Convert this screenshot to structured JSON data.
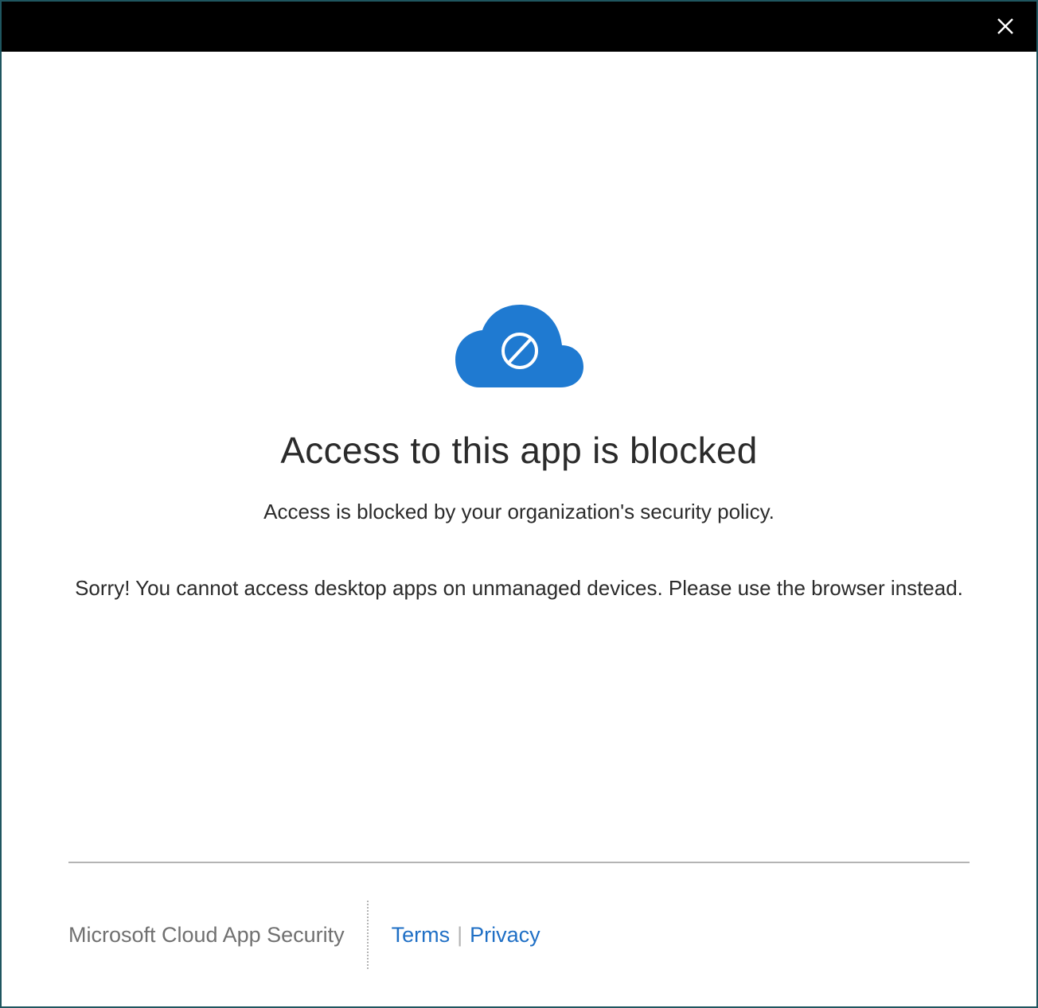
{
  "titlebar": {
    "close_icon": "close-icon"
  },
  "main": {
    "icon": "cloud-blocked-icon",
    "title": "Access to this app is blocked",
    "subtitle": "Access is blocked by your organization's security policy.",
    "message": "Sorry! You cannot access desktop apps on unmanaged devices. Please use the browser instead."
  },
  "footer": {
    "brand": "Microsoft Cloud App Security",
    "terms_label": "Terms",
    "separator": "|",
    "privacy_label": "Privacy"
  },
  "colors": {
    "titlebar_bg": "#000000",
    "cloud_blue": "#1f7ad1",
    "link_blue": "#1f6fc5",
    "text": "#2b2b2b",
    "footer_gray": "#707070",
    "window_border": "#1f5660"
  }
}
